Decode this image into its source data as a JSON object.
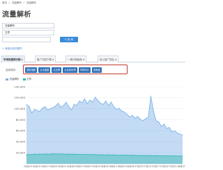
{
  "breadcrumb": {
    "home": "首页",
    "parent": "流量解析",
    "current": "流量解析"
  },
  "title": "流量解析",
  "keywords": [
    "流量解析",
    "文章",
    ""
  ],
  "query_button": "查 询",
  "add_link": "+ 添加比较关键词",
  "tabs": [
    {
      "label": "市场热搜排行榜",
      "has_dropdown": true
    },
    {
      "label": "推广词排下载",
      "has_dropdown": true
    },
    {
      "label": "一周词排版权",
      "has_dropdown": true
    },
    {
      "label": "线上推广排名",
      "has_dropdown": true
    }
  ],
  "category_label": "选择类别:",
  "categories": [
    "搜索指数",
    "点击指数",
    "点击率",
    "点击转化率",
    "市场均价",
    "竞争度"
  ],
  "colors": {
    "series1": "#7ab0e6",
    "series2": "#2fb8b0",
    "category_button": "#2d6fb8",
    "highlight": "#c0392b",
    "accent": "#3a8bd9"
  },
  "chart_data": {
    "type": "area",
    "ylim": [
      0,
      140000
    ],
    "yticks": [
      "20,000",
      "40,000",
      "60,000",
      "80,000",
      "100,000",
      "120,000",
      "140,000"
    ],
    "xticks": [
      "04月03",
      "04月10",
      "04月17",
      "04月24",
      "05月01",
      "05月08",
      "05月15",
      "05月22",
      "05月29",
      "06月05",
      "06月12",
      "06月19",
      "06月26",
      "07月03",
      "07月10",
      "07月17",
      "07月24",
      "07月31",
      "08月07"
    ],
    "series": [
      {
        "name": "流量解析",
        "values": [
          108000,
          104000,
          92000,
          99000,
          97000,
          95000,
          101000,
          104000,
          98000,
          100000,
          102000,
          105000,
          110000,
          103000,
          106000,
          112000,
          104000,
          98000,
          108000,
          106000,
          114000,
          111000,
          118000,
          109000,
          116000,
          112000,
          121000,
          115000,
          110000,
          108000,
          114000,
          106000,
          112000,
          104000,
          99000,
          101000,
          96000,
          94000,
          90000,
          85000,
          88000,
          83000,
          86000,
          81000,
          78000,
          82000,
          84000,
          123000,
          96000,
          78000,
          76000,
          68000,
          72000,
          64000,
          66000,
          58000,
          60000,
          56000,
          54000,
          52000
        ]
      },
      {
        "name": "文章",
        "values": [
          16000,
          17000,
          16500,
          17500,
          17000,
          17800,
          17200,
          18000,
          17400,
          17600,
          18200,
          17800,
          17500,
          18000,
          17700,
          17300,
          17600,
          17100,
          17400,
          16900,
          17200,
          16800,
          17000,
          16600,
          16800,
          16500,
          16700,
          16300,
          16500,
          16200,
          16000,
          16300,
          15900,
          16100,
          15800,
          15600,
          15900,
          15500,
          15700,
          15300,
          15500,
          15200,
          15000,
          15300,
          14900,
          15100,
          14800,
          15000,
          14700,
          14900,
          14600,
          14400,
          14700,
          14300,
          14500,
          14200,
          14400,
          14000,
          14200,
          13900
        ]
      }
    ]
  }
}
